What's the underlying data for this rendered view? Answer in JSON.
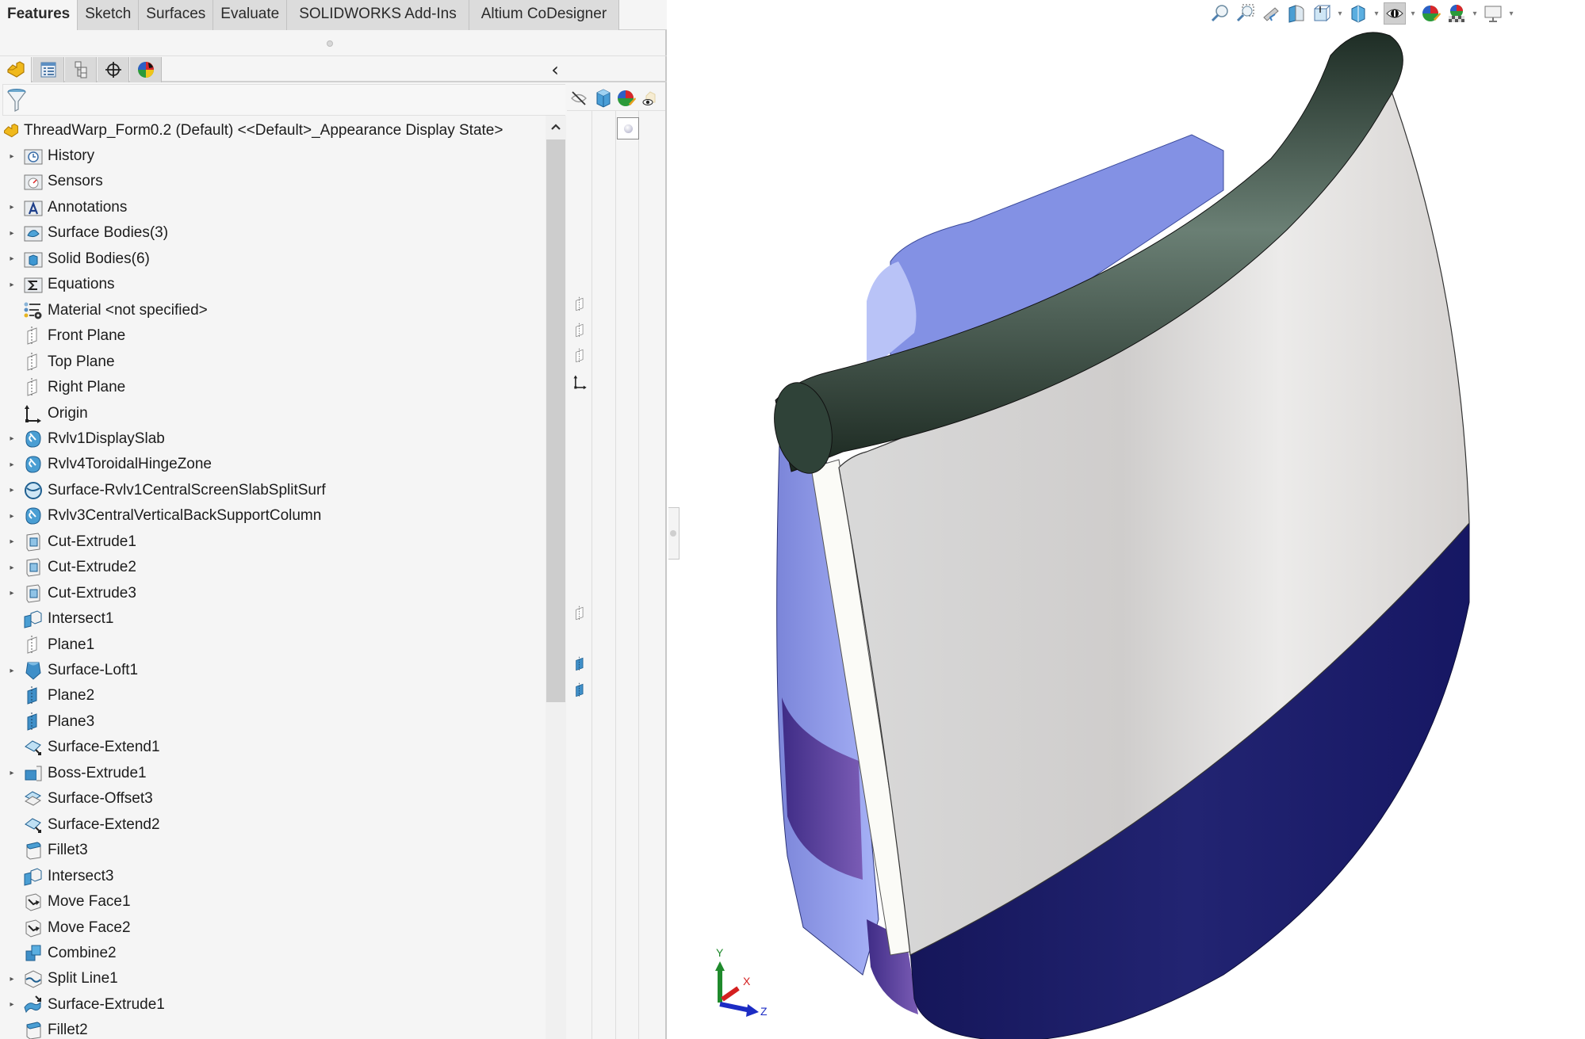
{
  "command_tabs": [
    {
      "label": "Features",
      "active": true
    },
    {
      "label": "Sketch",
      "active": false
    },
    {
      "label": "Surfaces",
      "active": false
    },
    {
      "label": "Evaluate",
      "active": false
    },
    {
      "label": "SOLIDWORKS Add-Ins",
      "active": false
    },
    {
      "label": "Altium CoDesigner",
      "active": false
    }
  ],
  "manager_tabs": [
    {
      "name": "featuremanager-tab",
      "icon": "part-icon",
      "active": true
    },
    {
      "name": "propertymanager-tab",
      "icon": "property-list-icon",
      "active": false
    },
    {
      "name": "configurationmanager-tab",
      "icon": "configuration-icon",
      "active": false
    },
    {
      "name": "dimxpertmanager-tab",
      "icon": "crosshair-icon",
      "active": false
    },
    {
      "name": "displaymanager-tab",
      "icon": "appearance-sphere-icon",
      "active": false
    }
  ],
  "collapse_glyph": "‹",
  "state_column_headers": [
    "hide-show-icon",
    "display-mode-icon",
    "appearance-icon",
    "transparency-icon"
  ],
  "tree": {
    "root_label": "ThreadWarp_Form0.2 (Default) <<Default>_Appearance Display State>",
    "items": [
      {
        "label": "History",
        "icon": "history-folder-icon",
        "expandable": true,
        "state": ""
      },
      {
        "label": "Sensors",
        "icon": "sensors-folder-icon",
        "expandable": false,
        "state": ""
      },
      {
        "label": "Annotations",
        "icon": "annotations-folder-icon",
        "expandable": true,
        "state": ""
      },
      {
        "label": "Surface Bodies(3)",
        "icon": "surface-bodies-folder-icon",
        "expandable": true,
        "state": ""
      },
      {
        "label": "Solid Bodies(6)",
        "icon": "solid-bodies-folder-icon",
        "expandable": true,
        "state": ""
      },
      {
        "label": "Equations",
        "icon": "equations-folder-icon",
        "expandable": true,
        "state": ""
      },
      {
        "label": "Material <not specified>",
        "icon": "material-icon",
        "expandable": false,
        "state": ""
      },
      {
        "label": "Front Plane",
        "icon": "plane-icon",
        "expandable": false,
        "state": "plane-hidden"
      },
      {
        "label": "Top Plane",
        "icon": "plane-icon",
        "expandable": false,
        "state": "plane-hidden"
      },
      {
        "label": "Right Plane",
        "icon": "plane-icon",
        "expandable": false,
        "state": "plane-hidden"
      },
      {
        "label": "Origin",
        "icon": "origin-icon",
        "expandable": false,
        "state": "origin"
      },
      {
        "label": "Rvlv1DisplaySlab",
        "icon": "revolve-icon",
        "expandable": true,
        "state": ""
      },
      {
        "label": "Rvlv4ToroidalHingeZone",
        "icon": "revolve-icon",
        "expandable": true,
        "state": ""
      },
      {
        "label": "Surface-Rvlv1CentralScreenSlabSplitSurf",
        "icon": "surface-revolve-icon",
        "expandable": true,
        "state": ""
      },
      {
        "label": "Rvlv3CentralVerticalBackSupportColumn",
        "icon": "revolve-icon",
        "expandable": true,
        "state": ""
      },
      {
        "label": "Cut-Extrude1",
        "icon": "cut-extrude-icon",
        "expandable": true,
        "state": ""
      },
      {
        "label": "Cut-Extrude2",
        "icon": "cut-extrude-icon",
        "expandable": true,
        "state": ""
      },
      {
        "label": "Cut-Extrude3",
        "icon": "cut-extrude-icon",
        "expandable": true,
        "state": ""
      },
      {
        "label": "Intersect1",
        "icon": "intersect-icon",
        "expandable": false,
        "state": ""
      },
      {
        "label": "Plane1",
        "icon": "plane-icon",
        "expandable": false,
        "state": "plane-hidden"
      },
      {
        "label": "Surface-Loft1",
        "icon": "surface-loft-icon",
        "expandable": true,
        "state": ""
      },
      {
        "label": "Plane2",
        "icon": "plane-shown-icon",
        "expandable": false,
        "state": "plane-shown"
      },
      {
        "label": "Plane3",
        "icon": "plane-shown-icon",
        "expandable": false,
        "state": "plane-shown"
      },
      {
        "label": "Surface-Extend1",
        "icon": "surface-extend-icon",
        "expandable": false,
        "state": ""
      },
      {
        "label": "Boss-Extrude1",
        "icon": "boss-extrude-icon",
        "expandable": true,
        "state": ""
      },
      {
        "label": "Surface-Offset3",
        "icon": "surface-offset-icon",
        "expandable": false,
        "state": ""
      },
      {
        "label": "Surface-Extend2",
        "icon": "surface-extend-icon",
        "expandable": false,
        "state": ""
      },
      {
        "label": "Fillet3",
        "icon": "fillet-icon",
        "expandable": false,
        "state": ""
      },
      {
        "label": "Intersect3",
        "icon": "intersect-icon",
        "expandable": false,
        "state": ""
      },
      {
        "label": "Move Face1",
        "icon": "move-face-icon",
        "expandable": false,
        "state": ""
      },
      {
        "label": "Move Face2",
        "icon": "move-face-icon",
        "expandable": false,
        "state": ""
      },
      {
        "label": "Combine2",
        "icon": "combine-icon",
        "expandable": false,
        "state": ""
      },
      {
        "label": "Split Line1",
        "icon": "split-line-icon",
        "expandable": true,
        "state": ""
      },
      {
        "label": "Surface-Extrude1",
        "icon": "surface-extrude-icon",
        "expandable": true,
        "state": ""
      },
      {
        "label": "Fillet2",
        "icon": "fillet-icon",
        "expandable": false,
        "state": ""
      }
    ]
  },
  "heads_up_toolbar": [
    {
      "name": "zoom-to-fit-icon",
      "dropdown": false,
      "pressed": false
    },
    {
      "name": "zoom-to-area-icon",
      "dropdown": false,
      "pressed": false
    },
    {
      "name": "previous-view-icon",
      "dropdown": false,
      "pressed": false
    },
    {
      "name": "section-view-icon",
      "dropdown": false,
      "pressed": false
    },
    {
      "name": "view-orientation-icon",
      "dropdown": true,
      "pressed": false
    },
    {
      "name": "display-style-icon",
      "dropdown": true,
      "pressed": false
    },
    {
      "name": "hide-show-items-icon",
      "dropdown": true,
      "pressed": true
    },
    {
      "name": "edit-appearance-icon",
      "dropdown": false,
      "pressed": false
    },
    {
      "name": "apply-scene-icon",
      "dropdown": true,
      "pressed": false
    },
    {
      "name": "view-settings-icon",
      "dropdown": true,
      "pressed": false
    }
  ],
  "triad": {
    "x_label": "X",
    "y_label": "Y",
    "z_label": "Z"
  },
  "colors": {
    "accent_tab_bg": "#dcdcdc",
    "model_rod": "#2f4238",
    "model_face": "#e4e3e2",
    "model_base": "#1e1f66",
    "model_side": "#8e9be8",
    "model_purple": "#6a4fa8"
  }
}
